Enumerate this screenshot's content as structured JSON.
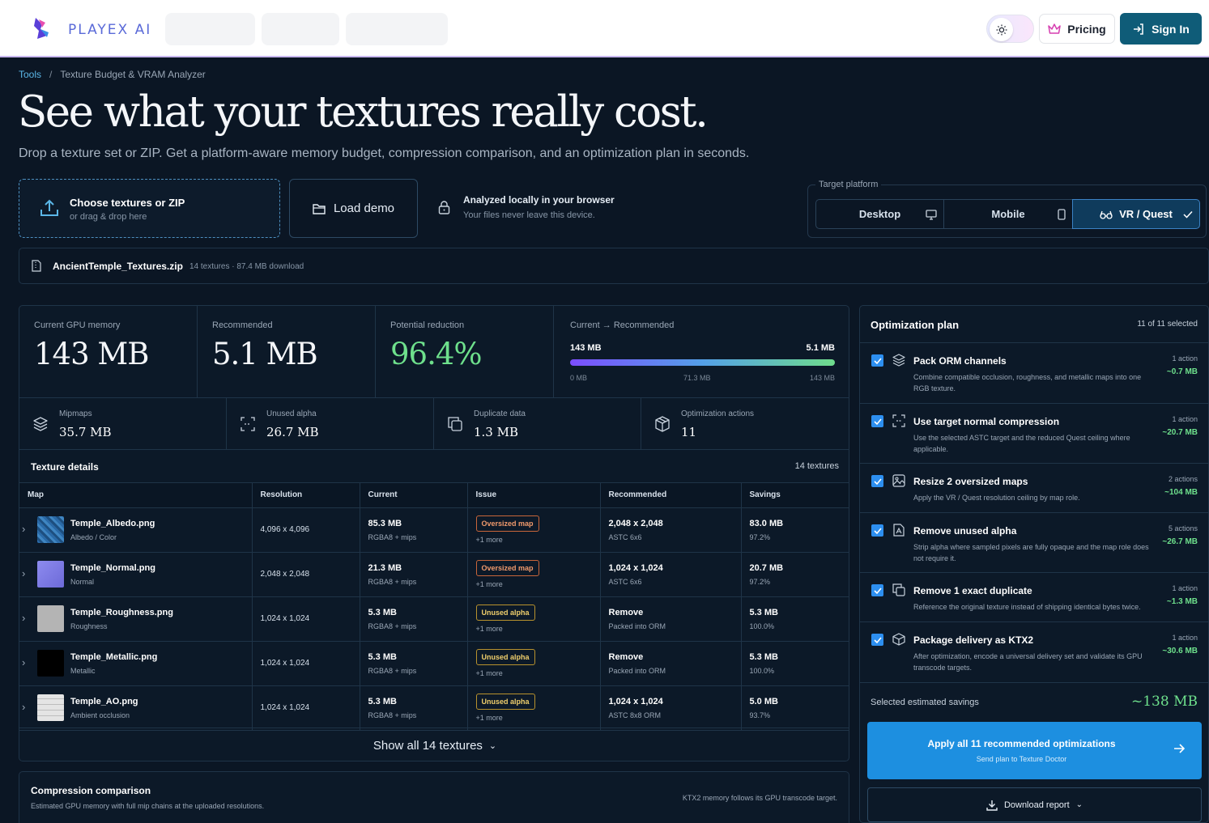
{
  "header": {
    "brand": "PLAYEX AI",
    "pricing_label": "Pricing",
    "signin_label": "Sign In"
  },
  "breadcrumb": {
    "root": "Tools",
    "separator": "/",
    "current": "Texture Budget & VRAM Analyzer"
  },
  "hero": {
    "title": "See what your textures really cost.",
    "subtitle": "Drop a texture set or ZIP. Get a platform-aware memory budget, compression comparison, and an optimization plan in seconds."
  },
  "upload": {
    "title": "Choose textures or ZIP",
    "hint": "or drag & drop here"
  },
  "demo_label": "Load demo",
  "local": {
    "title": "Analyzed locally in your browser",
    "sub": "Your files never leave this device."
  },
  "platform": {
    "legend": "Target platform",
    "options": [
      {
        "label": "Desktop",
        "icon": "monitor-icon",
        "selected": false
      },
      {
        "label": "Mobile",
        "icon": "phone-icon",
        "selected": false
      },
      {
        "label": "VR / Quest",
        "icon": "vr-glasses-icon",
        "selected": true
      }
    ]
  },
  "file": {
    "name": "AncientTemple_Textures.zip",
    "meta": "14 textures · 87.4 MB download"
  },
  "stats": {
    "current": {
      "label": "Current GPU memory",
      "value": "143 MB"
    },
    "recommended": {
      "label": "Recommended",
      "value": "5.1 MB"
    },
    "reduction": {
      "label": "Potential reduction",
      "value": "96.4%"
    },
    "bar": {
      "label_from": "Current",
      "label_to": "Recommended",
      "left_value": "143 MB",
      "right_value": "5.1 MB",
      "ticks": [
        "0 MB",
        "71.3 MB",
        "143 MB"
      ],
      "fill_fraction": 1.0
    }
  },
  "substats": [
    {
      "label": "Mipmaps",
      "value": "35.7 MB",
      "icon": "layers-icon"
    },
    {
      "label": "Unused alpha",
      "value": "26.7 MB",
      "icon": "alpha-scan-icon"
    },
    {
      "label": "Duplicate data",
      "value": "1.3 MB",
      "icon": "copy-icon"
    },
    {
      "label": "Optimization actions",
      "value": "11",
      "icon": "package-icon"
    }
  ],
  "texture_details": {
    "title": "Texture details",
    "count": "14 textures",
    "columns": [
      "Map",
      "Resolution",
      "Current",
      "Issue",
      "Recommended",
      "Savings"
    ],
    "rows": [
      {
        "name": "Temple_Albedo.png",
        "role": "Albedo / Color",
        "thumb": "#2a6aa8",
        "resolution": "4,096 x 4,096",
        "current": "85.3 MB",
        "current_fmt": "RGBA8 + mips",
        "issue": "Oversized map",
        "issue_kind": "over",
        "more": "+1 more",
        "rec": "2,048 x 2,048",
        "rec_fmt": "ASTC 6x6",
        "saving": "83.0 MB",
        "saving_pct": "97.2%"
      },
      {
        "name": "Temple_Normal.png",
        "role": "Normal",
        "thumb": "#7a7ae0",
        "resolution": "2,048 x 2,048",
        "current": "21.3 MB",
        "current_fmt": "RGBA8 + mips",
        "issue": "Oversized map",
        "issue_kind": "over",
        "more": "+1 more",
        "rec": "1,024 x 1,024",
        "rec_fmt": "ASTC 6x6",
        "saving": "20.7 MB",
        "saving_pct": "97.2%"
      },
      {
        "name": "Temple_Roughness.png",
        "role": "Roughness",
        "thumb": "#b4b4b4",
        "resolution": "1,024 x 1,024",
        "current": "5.3 MB",
        "current_fmt": "RGBA8 + mips",
        "issue": "Unused alpha",
        "issue_kind": "alpha",
        "more": "+1 more",
        "rec": "Remove",
        "rec_fmt": "Packed into ORM",
        "saving": "5.3 MB",
        "saving_pct": "100.0%"
      },
      {
        "name": "Temple_Metallic.png",
        "role": "Metallic",
        "thumb": "#000000",
        "resolution": "1,024 x 1,024",
        "current": "5.3 MB",
        "current_fmt": "RGBA8 + mips",
        "issue": "Unused alpha",
        "issue_kind": "alpha",
        "more": "+1 more",
        "rec": "Remove",
        "rec_fmt": "Packed into ORM",
        "saving": "5.3 MB",
        "saving_pct": "100.0%"
      },
      {
        "name": "Temple_AO.png",
        "role": "Ambient occlusion",
        "thumb": "#dcdcdc",
        "resolution": "1,024 x 1,024",
        "current": "5.3 MB",
        "current_fmt": "RGBA8 + mips",
        "issue": "Unused alpha",
        "issue_kind": "alpha",
        "more": "+1 more",
        "rec": "1,024 x 1,024",
        "rec_fmt": "ASTC 8x8 ORM",
        "saving": "5.0 MB",
        "saving_pct": "93.7%"
      }
    ],
    "show_all": "Show all 14 textures"
  },
  "compression": {
    "title": "Compression comparison",
    "sub": "Estimated GPU memory with full mip chains at the uploaded resolutions.",
    "note": "KTX2 memory follows its GPU transcode target."
  },
  "plan": {
    "title": "Optimization plan",
    "selected": "11 of 11 selected",
    "items": [
      {
        "title": "Pack ORM channels",
        "desc": "Combine compatible occlusion, roughness, and metallic maps into one RGB texture.",
        "actions": "1 action",
        "saving": "~0.7 MB",
        "icon": "layers-icon"
      },
      {
        "title": "Use target normal compression",
        "desc": "Use the selected ASTC target and the reduced Quest ceiling where applicable.",
        "actions": "1 action",
        "saving": "~20.7 MB",
        "icon": "compress-icon"
      },
      {
        "title": "Resize 2 oversized maps",
        "desc": "Apply the VR / Quest resolution ceiling by map role.",
        "actions": "2 actions",
        "saving": "~104 MB",
        "icon": "image-resize-icon"
      },
      {
        "title": "Remove unused alpha",
        "desc": "Strip alpha where sampled pixels are fully opaque and the map role does not require it.",
        "actions": "5 actions",
        "saving": "~26.7 MB",
        "icon": "alpha-file-icon"
      },
      {
        "title": "Remove 1 exact duplicate",
        "desc": "Reference the original texture instead of shipping identical bytes twice.",
        "actions": "1 action",
        "saving": "~1.3 MB",
        "icon": "copy-icon"
      },
      {
        "title": "Package delivery as KTX2",
        "desc": "After optimization, encode a universal delivery set and validate its GPU transcode targets.",
        "actions": "1 action",
        "saving": "~30.6 MB",
        "icon": "package-icon"
      }
    ],
    "total_label": "Selected estimated savings",
    "total_value": "~138 MB",
    "apply_title": "Apply all 11 recommended optimizations",
    "apply_sub": "Send plan to Texture Doctor",
    "download_label": "Download report"
  },
  "colors": {
    "accent": "#1d8fe0",
    "success": "#6ee08c",
    "warning": "#f0cf6c",
    "danger": "#f19a6c",
    "background": "#0b1624"
  }
}
